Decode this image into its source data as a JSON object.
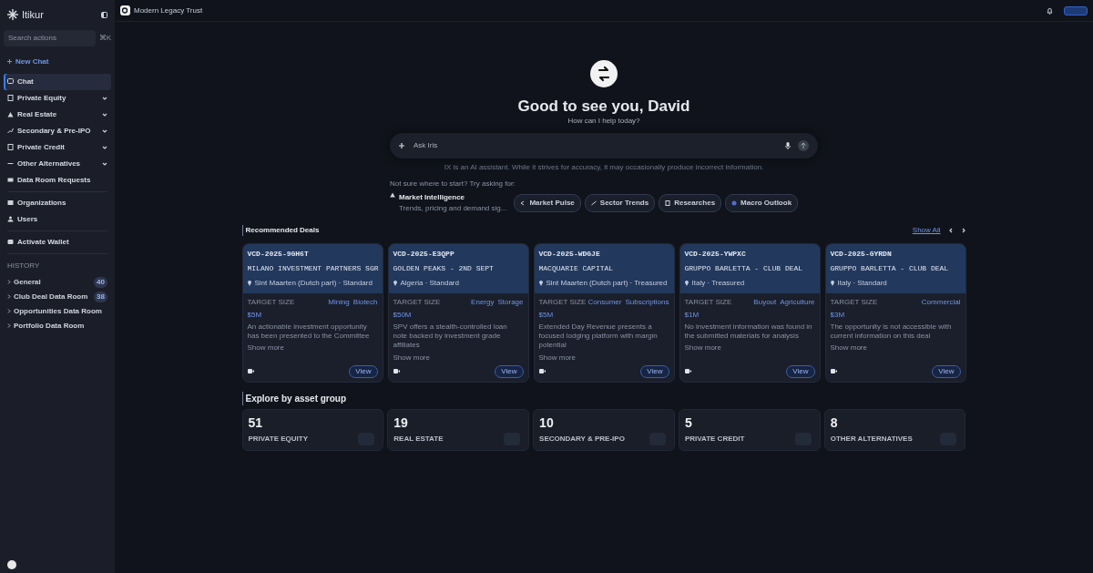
{
  "sidebar": {
    "brand": "Itikur",
    "search": {
      "placeholder": "Search actions",
      "shortcut": "⌘K"
    },
    "new_chat": "New Chat",
    "items": [
      {
        "label": "Chat",
        "kind": "link",
        "selected": true
      },
      {
        "label": "Private Equity",
        "kind": "group",
        "selected": false,
        "expanded": false
      },
      {
        "label": "Real Estate",
        "kind": "group",
        "selected": false,
        "expanded": false
      },
      {
        "label": "Secondary & Pre-IPO",
        "kind": "group",
        "selected": false,
        "expanded": false
      },
      {
        "label": "Private Credit",
        "kind": "group",
        "selected": false,
        "expanded": false
      },
      {
        "label": "Other Alternatives",
        "kind": "group",
        "selected": false,
        "expanded": false
      },
      {
        "label": "Data Room Requests",
        "kind": "link",
        "selected": false
      },
      {
        "label": "Organizations",
        "kind": "link",
        "selected": false
      },
      {
        "label": "Users",
        "kind": "link",
        "selected": false
      },
      {
        "label": "Activate Wallet",
        "kind": "link",
        "selected": false
      }
    ],
    "history_title": "HISTORY",
    "history": [
      {
        "label": "General",
        "count": "40"
      },
      {
        "label": "Club Deal Data Room",
        "count": "38"
      },
      {
        "label": "Opportunities Data Room"
      },
      {
        "label": "Portfolio Data Room"
      }
    ]
  },
  "header": {
    "workspace": "Modern Legacy Trust",
    "toggle": {
      "on": true
    }
  },
  "hero": {
    "title": "Good to see you, David",
    "subtitle": "How can I help today?",
    "input": {
      "placeholder": "Ask Iris"
    },
    "disclaimer": "IX is an AI assistant. While it strives for accuracy, it may occasionally produce incorrect information.",
    "prompt_hint": "Not sure where to start? Try asking for:",
    "suggestion": {
      "title": "Market Intelligence",
      "subtitle": "Trends, pricing and demand sig..."
    },
    "chips": [
      "Market Pulse",
      "Sector Trends",
      "Researches",
      "Macro Outlook"
    ]
  },
  "deals": {
    "title": "Recommended Deals",
    "show_all": "Show All",
    "items": [
      {
        "code": "VCD-2025-9GH6T",
        "name": "MILANO INVESTMENT PARTNERS SGR",
        "location": "Sint Maarten (Dutch part) · Standard",
        "size_label": "TARGET SIZE",
        "size": "$5M",
        "tags": [
          "Mining",
          "Biotech"
        ],
        "description": "An actionable investment opportunity has been presented to the Committee",
        "more": "Show more",
        "action": "View"
      },
      {
        "code": "VCD-2025-E3QPP",
        "name": "GOLDEN PEAKS - 2ND SEPT",
        "location": "Algeria · Standard",
        "size_label": "TARGET SIZE",
        "size": "$50M",
        "tags": [
          "Energy",
          "Storage"
        ],
        "description": "SPV offers a stealth-controlled loan note backed by investment grade affiliates",
        "more": "Show more",
        "action": "View"
      },
      {
        "code": "VCD-2025-WDGJE",
        "name": "MACQUARIE CAPITAL",
        "location": "Sint Maarten (Dutch part) · Treasured",
        "size_label": "TARGET SIZE",
        "size": "$5M",
        "tags": [
          "Consumer",
          "Subscriptions"
        ],
        "description": "Extended Day Revenue presents a focused lodging platform with margin potential",
        "more": "Show more",
        "action": "View"
      },
      {
        "code": "VCD-2025-YWPXC",
        "name": "GRUPPO BARLETTA - CLUB DEAL",
        "location": "Italy · Treasured",
        "size_label": "TARGET SIZE",
        "size": "$1M",
        "tags": [
          "Buyout",
          "Agriculture"
        ],
        "description": "No investment information was found in the submitted materials for analysis",
        "more": "Show more",
        "action": "View"
      },
      {
        "code": "VCD-2025-GYRDN",
        "name": "GRUPPO BARLETTA - CLUB DEAL",
        "location": "Italy · Standard",
        "size_label": "TARGET SIZE",
        "size": "$3M",
        "tags": [
          "Commercial"
        ],
        "description": "The opportunity is not accessible with current information on this deal",
        "more": "Show more",
        "action": "View"
      }
    ]
  },
  "explore": {
    "title": "Explore by asset group",
    "groups": [
      {
        "count": "51",
        "label": "PRIVATE EQUITY"
      },
      {
        "count": "19",
        "label": "REAL ESTATE"
      },
      {
        "count": "10",
        "label": "SECONDARY & PRE-IPO"
      },
      {
        "count": "5",
        "label": "PRIVATE CREDIT"
      },
      {
        "count": "8",
        "label": "OTHER ALTERNATIVES"
      }
    ]
  }
}
